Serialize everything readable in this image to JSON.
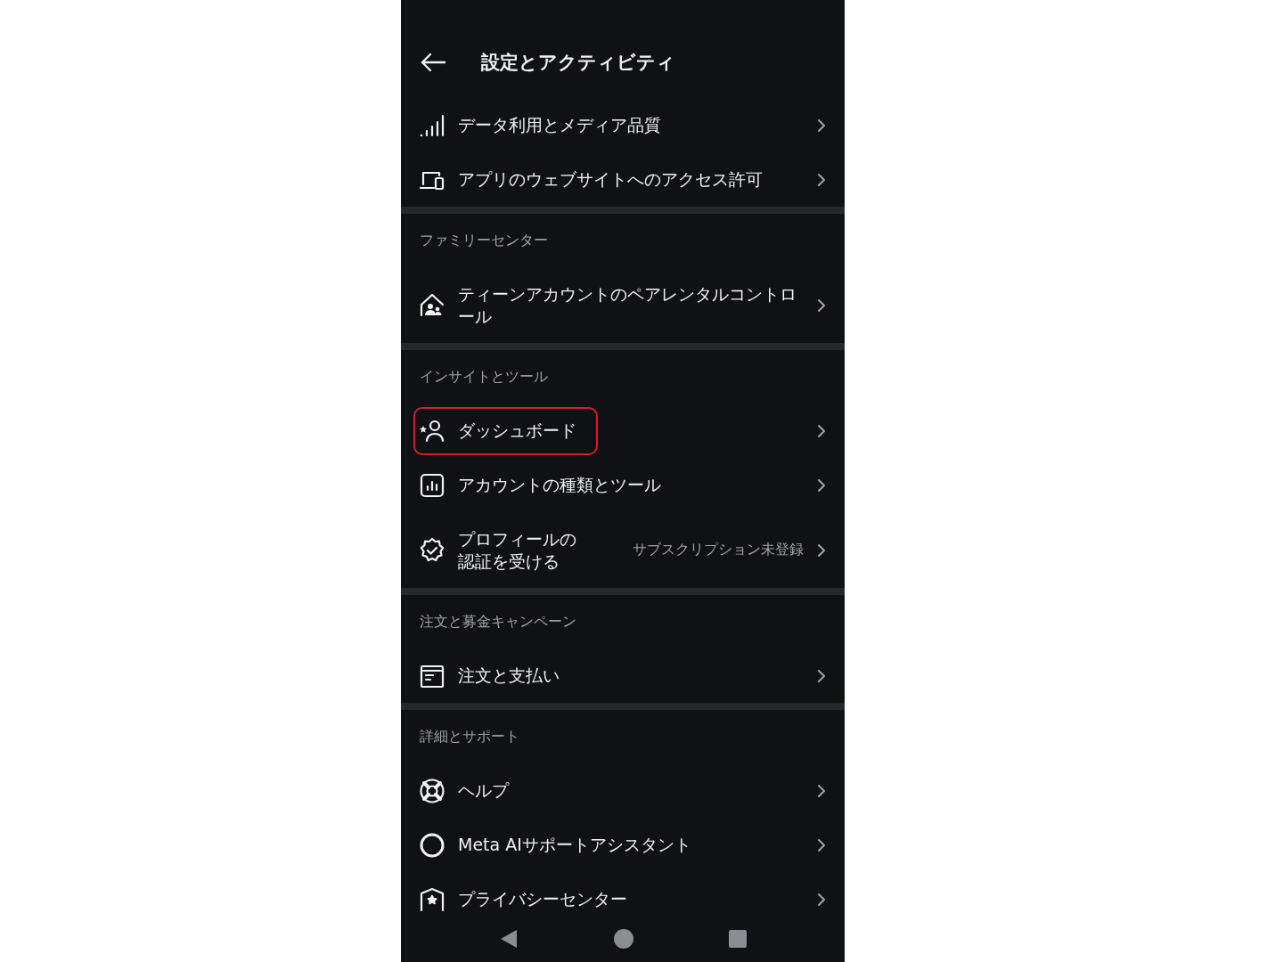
{
  "header": {
    "title": "設定とアクティビティ"
  },
  "sections": [
    {
      "items": [
        {
          "label": "データ利用とメディア品質",
          "highlighted": false
        },
        {
          "label": "アプリのウェブサイトへのアクセス許可",
          "highlighted": false
        }
      ]
    },
    {
      "title": "ファミリーセンター",
      "items": [
        {
          "label": "ティーンアカウントのペアレンタルコントロール",
          "highlighted": false
        }
      ]
    },
    {
      "title": "インサイトとツール",
      "items": [
        {
          "label": "ダッシュボード",
          "highlighted": true
        },
        {
          "label": "アカウントの種類とツール",
          "highlighted": false
        },
        {
          "label": "プロフィールの認証を受ける",
          "value": "サブスクリプション未登録",
          "highlighted": false
        }
      ]
    },
    {
      "title": "注文と募金キャンペーン",
      "items": [
        {
          "label": "注文と支払い",
          "highlighted": false
        }
      ]
    },
    {
      "title": "詳細とサポート",
      "items": [
        {
          "label": "ヘルプ",
          "highlighted": false
        },
        {
          "label": "Meta AIサポートアシスタント",
          "highlighted": false
        },
        {
          "label": "プライバシーセンター",
          "highlighted": false
        }
      ]
    }
  ]
}
